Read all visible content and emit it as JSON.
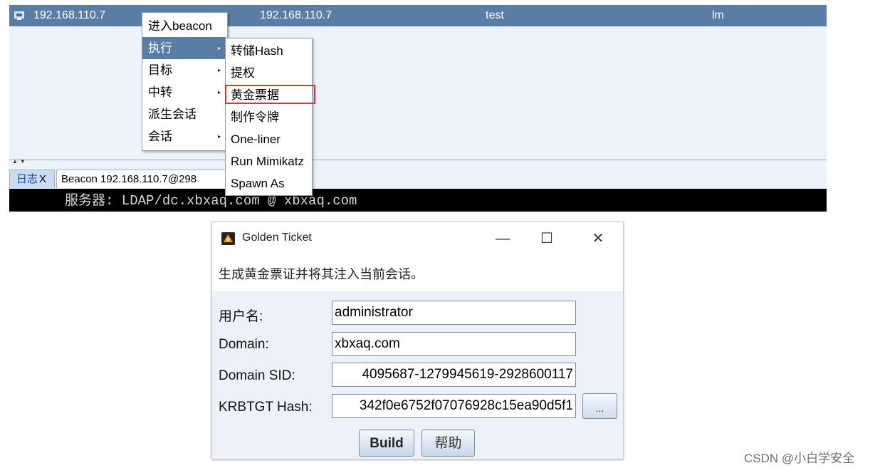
{
  "session": {
    "external_ip": "192.168.110.7",
    "internal_ip": "192.168.110.7",
    "user": "test",
    "computer": "lm"
  },
  "tabs": {
    "log_label": "日志",
    "log_close": "X",
    "beacon_label": "Beacon 192.168.110.7@298"
  },
  "console": {
    "line": "服务器: LDAP/dc.xbxaq.com @ xbxaq.com"
  },
  "context_menu": {
    "items": [
      {
        "label": "进入beacon",
        "has_submenu": false
      },
      {
        "label": "执行",
        "has_submenu": true,
        "active": true
      },
      {
        "label": "目标",
        "has_submenu": true
      },
      {
        "label": "中转",
        "has_submenu": true
      },
      {
        "label": "派生会话",
        "has_submenu": false
      },
      {
        "label": "会话",
        "has_submenu": true
      }
    ],
    "submenu_arrow": "▸"
  },
  "execute_submenu": {
    "items": [
      {
        "label": "转储Hash"
      },
      {
        "label": "提权"
      },
      {
        "label": "黄金票据",
        "highlighted": true
      },
      {
        "label": "制作令牌"
      },
      {
        "label": "One-liner"
      },
      {
        "label": "Run Mimikatz"
      },
      {
        "label": "Spawn As"
      }
    ],
    "highlight_color": "#e03030"
  },
  "dialog": {
    "title": "Golden Ticket",
    "min_glyph": "—",
    "max_glyph": "☐",
    "close_glyph": "✕",
    "description": "生成黄金票证并将其注入当前会话。",
    "fields": [
      {
        "label": "用户名:",
        "value": "administrator"
      },
      {
        "label": "Domain:",
        "value": "xbxaq.com"
      },
      {
        "label": "Domain SID:",
        "value": "4095687-1279945619-2928600117"
      },
      {
        "label": "KRBTGT Hash:",
        "value": "342f0e6752f07076928c15ea90d5f1"
      }
    ],
    "browse_label": "...",
    "build_label": "Build",
    "help_label": "帮助"
  },
  "watermark": "CSDN @小白学安全",
  "colors": {
    "row_selected": "#5a7da6",
    "menu_active": "#5a7da6",
    "console_bg": "#000000"
  }
}
